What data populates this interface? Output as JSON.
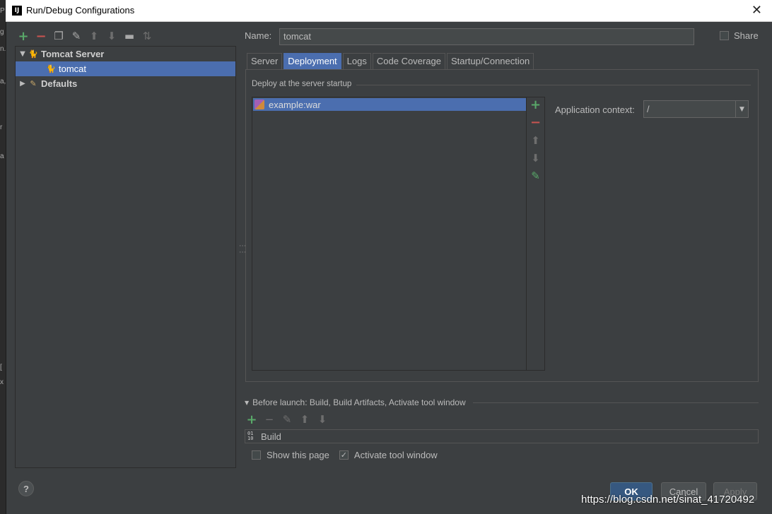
{
  "window": {
    "title": "Run/Debug Configurations",
    "icon_text": "IJ"
  },
  "background_marks": [
    "P",
    "n.",
    "g",
    "a,t",
    "r",
    "a",
    "[",
    "x"
  ],
  "toolbar": {
    "icons": [
      "add-icon",
      "remove-icon",
      "copy-icon",
      "wrench-icon",
      "move-up-icon",
      "move-down-icon",
      "folder-icon",
      "sort-icon"
    ]
  },
  "tree": {
    "items": [
      {
        "label": "Tomcat Server",
        "expanded": true
      },
      {
        "label": "tomcat",
        "selected": true
      },
      {
        "label": "Defaults",
        "expanded": false
      }
    ]
  },
  "name": {
    "label": "Name:",
    "value": "tomcat"
  },
  "share": {
    "label": "Share",
    "checked": false
  },
  "tabs": [
    {
      "label": "Server",
      "active": false
    },
    {
      "label": "Deployment",
      "active": true
    },
    {
      "label": "Logs",
      "active": false
    },
    {
      "label": "Code Coverage",
      "active": false
    },
    {
      "label": "Startup/Connection",
      "active": false
    }
  ],
  "deployment": {
    "group_title": "Deploy at the server startup",
    "items": [
      "example:war"
    ],
    "context_label": "Application context:",
    "context_value": "/"
  },
  "before_launch": {
    "title": "Before launch: Build, Build Artifacts, Activate tool window",
    "items": [
      "Build"
    ],
    "show_page_label": "Show this page",
    "show_page_checked": false,
    "activate_label": "Activate tool window",
    "activate_checked": true
  },
  "buttons": {
    "ok": "OK",
    "cancel": "Cancel",
    "apply": "Apply",
    "help": "?"
  },
  "watermark": "https://blog.csdn.net/sinat_41720492",
  "colors": {
    "selection": "#4b6eaf",
    "add": "#59a869",
    "remove": "#c75450",
    "panel": "#3c3f41"
  }
}
